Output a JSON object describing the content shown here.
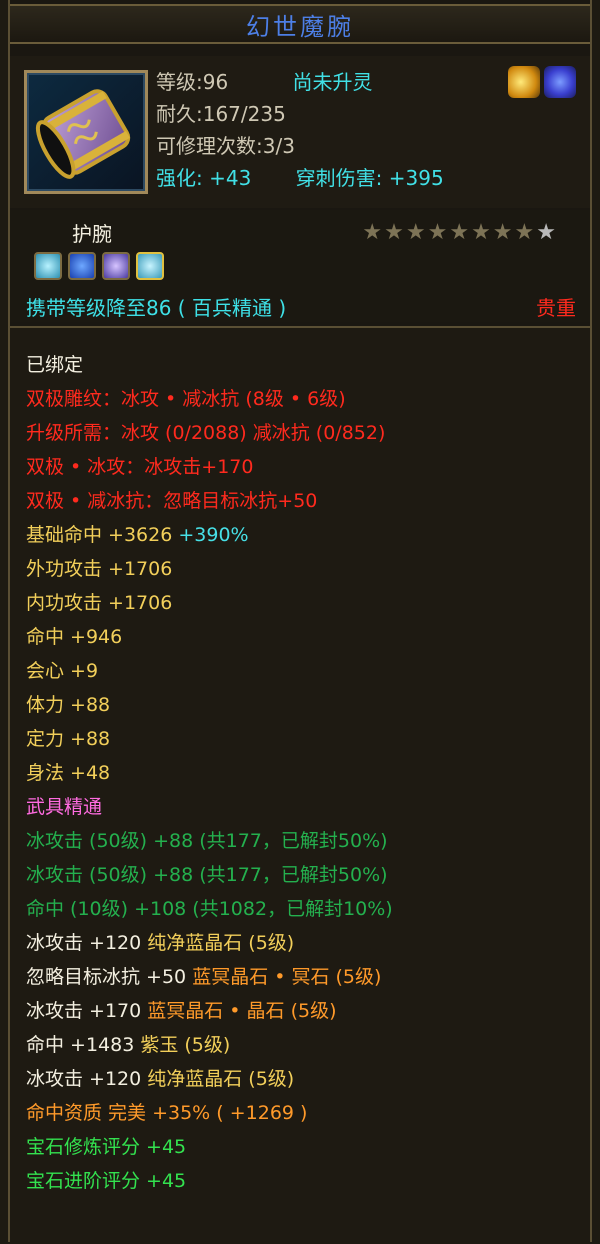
{
  "title": "幻世魔腕",
  "header": {
    "level": "等级:96",
    "spirit": "尚未升灵",
    "durability": "耐久:167/235",
    "repair": "可修理次数:3/3",
    "strengthen": "强化: +43",
    "pierce": "穿刺伤害: +395"
  },
  "item_type": "护腕",
  "stars": {
    "filled": 8,
    "total": 9
  },
  "carry": "携带等级降至86 ( 百兵精通 )",
  "valuable": "贵重",
  "bound": "已绑定",
  "lines": [
    {
      "text": "双极雕纹：冰攻 • 减冰抗 (8级 • 6级)",
      "cls": "red"
    },
    {
      "text": "升级所需：冰攻 (0/2088)   减冰抗 (0/852)",
      "cls": "red"
    },
    {
      "text": "双极 • 冰攻：冰攻击+170",
      "cls": "red"
    },
    {
      "text": "双极 • 减冰抗：忽略目标冰抗+50",
      "cls": "red"
    },
    {
      "text": "基础命中 +3626 ",
      "cls": "yellow",
      "extra": "+390%",
      "extra_cls": "blue-s"
    },
    {
      "text": "外功攻击 +1706",
      "cls": "yellow"
    },
    {
      "text": "内功攻击 +1706",
      "cls": "yellow"
    },
    {
      "text": "命中 +946",
      "cls": "yellow"
    },
    {
      "text": "会心 +9",
      "cls": "yellow"
    },
    {
      "text": "体力 +88",
      "cls": "yellow"
    },
    {
      "text": "定力 +88",
      "cls": "yellow"
    },
    {
      "text": "身法 +48",
      "cls": "yellow"
    },
    {
      "text": "武具精通",
      "cls": "pink"
    },
    {
      "text": "冰攻击 (50级) +88 (共177，已解封50%)",
      "cls": "green-d"
    },
    {
      "text": "冰攻击 (50级) +88 (共177，已解封50%)",
      "cls": "green-d"
    },
    {
      "text": "命中 (10级) +108 (共1082，已解封10%)",
      "cls": "green-d"
    },
    {
      "text": "冰攻击 +120 ",
      "cls": "white",
      "extra": "纯净蓝晶石 (5级)",
      "extra_cls": "yellow"
    },
    {
      "text": "忽略目标冰抗 +50 ",
      "cls": "white",
      "extra": "蓝冥晶石 • 冥石 (5级)",
      "extra_cls": "orange"
    },
    {
      "text": "冰攻击 +170 ",
      "cls": "white",
      "extra": "蓝冥晶石 • 晶石 (5级)",
      "extra_cls": "orange"
    },
    {
      "text": "命中 +1483 ",
      "cls": "white",
      "extra": "紫玉 (5级)",
      "extra_cls": "yellow"
    },
    {
      "text": "冰攻击 +120 ",
      "cls": "white",
      "extra": "纯净蓝晶石 (5级)",
      "extra_cls": "yellow"
    },
    {
      "text": "命中资质   完美 +35% ( +1269 )",
      "cls": "orange"
    },
    {
      "text": "宝石修炼评分 +45",
      "cls": "green-b"
    },
    {
      "text": "宝石进阶评分 +45",
      "cls": "green-b"
    }
  ],
  "colors": {
    "title": "#4d7fe6",
    "red": "#ff2a1e",
    "yellow": "#f2cf5a",
    "cyan": "#41e0e6",
    "pink": "#ff6be0",
    "green": "#24b04e",
    "bright_green": "#33e24f",
    "orange": "#ff9a2a"
  },
  "icons": [
    "bracer-item-icon",
    "phoenix-skill-icon",
    "blue-feather-icon",
    "gem-slot-cyan-icon",
    "gem-slot-blue-icon",
    "gem-slot-purple-icon",
    "gem-slot-yellow-icon"
  ]
}
